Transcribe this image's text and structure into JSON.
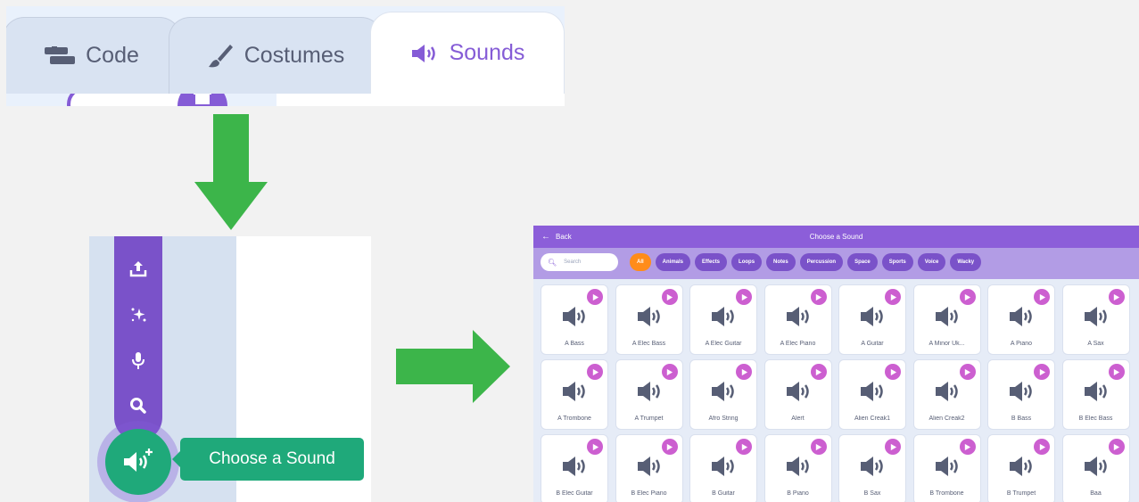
{
  "tabs": [
    {
      "label": "Code",
      "icon": "code-blocks-icon",
      "active": false
    },
    {
      "label": "Costumes",
      "icon": "paintbrush-icon",
      "active": false
    },
    {
      "label": "Sounds",
      "icon": "speaker-icon",
      "active": true
    }
  ],
  "menu": {
    "items": [
      "upload-icon",
      "surprise-sparkle-icon",
      "microphone-icon",
      "search-icon"
    ],
    "main_button_icon": "add-sound-icon",
    "tooltip": "Choose a Sound"
  },
  "library": {
    "back_label": "Back",
    "title": "Choose a Sound",
    "search_placeholder": "Search",
    "categories": [
      "All",
      "Animals",
      "Effects",
      "Loops",
      "Notes",
      "Percussion",
      "Space",
      "Sports",
      "Voice",
      "Wacky"
    ],
    "active_category": "All",
    "sounds": [
      "A Bass",
      "A Elec Bass",
      "A Elec Guitar",
      "A Elec Piano",
      "A Guitar",
      "A Minor Uk...",
      "A Piano",
      "A Sax",
      "A Trombone",
      "A Trumpet",
      "Afro String",
      "Alert",
      "Alien Creak1",
      "Alien Creak2",
      "B Bass",
      "B Elec Bass",
      "B Elec Guitar",
      "B Elec Piano",
      "B Guitar",
      "B Piano",
      "B Sax",
      "B Trombone",
      "B Trumpet",
      "Baa"
    ]
  },
  "colors": {
    "scratch_purple": "#855cd6",
    "menu_purple": "#7a52c9",
    "green": "#1fa97a",
    "arrow_green": "#3cb54a",
    "active_chip": "#ff8c1a",
    "play_pink": "#cc5fd0"
  }
}
